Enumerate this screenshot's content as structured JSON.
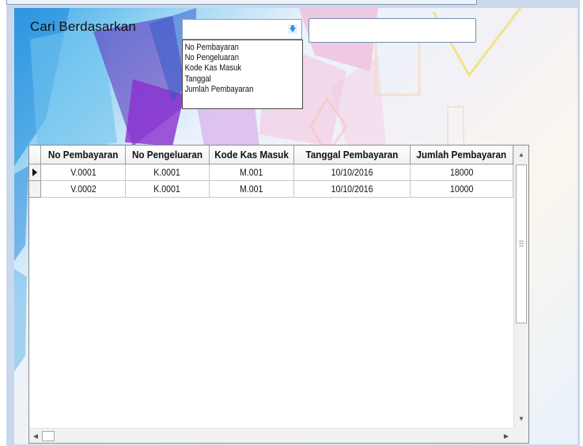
{
  "search": {
    "label": "Cari Berdasarkan",
    "selected_value": "",
    "text_value": "",
    "options": [
      "No Pembayaran",
      "No Pengeluaran",
      "Kode Kas Masuk",
      "Tanggal",
      "Jumlah Pembayaran"
    ]
  },
  "grid": {
    "columns": [
      "No Pembayaran",
      "No Pengeluaran",
      "Kode Kas Masuk",
      "Tanggal Pembayaran",
      "Jumlah Pembayaran"
    ],
    "rows": [
      [
        "V.0001",
        "K.0001",
        "M.001",
        "10/10/2016",
        "18000"
      ],
      [
        "V.0002",
        "K.0001",
        "M.001",
        "10/10/2016",
        "10000"
      ]
    ],
    "current_row_marker": "row-pointer-icon"
  },
  "colors": {
    "accent": "#3c8fd6",
    "frame": "#c9d8ea",
    "grid_border": "#8a8a8a"
  }
}
